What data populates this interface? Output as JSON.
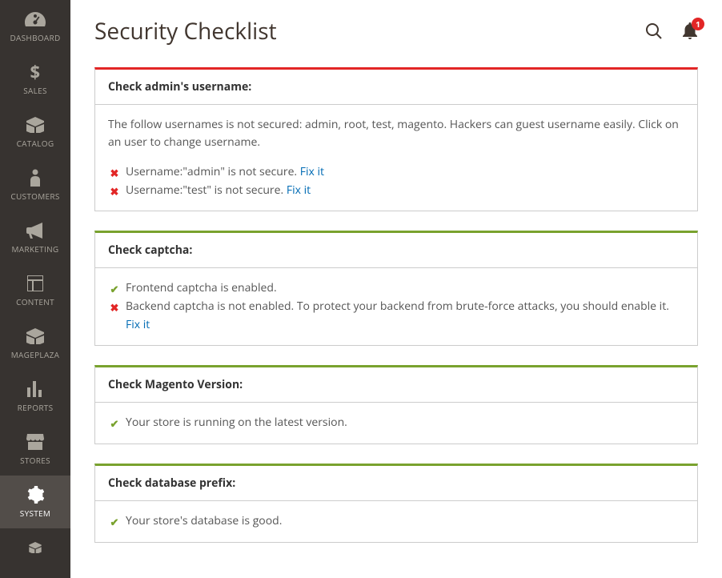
{
  "sidebar": {
    "items": [
      {
        "label": "DASHBOARD",
        "icon": "gauge"
      },
      {
        "label": "SALES",
        "icon": "dollar"
      },
      {
        "label": "CATALOG",
        "icon": "box"
      },
      {
        "label": "CUSTOMERS",
        "icon": "person"
      },
      {
        "label": "MARKETING",
        "icon": "megaphone"
      },
      {
        "label": "CONTENT",
        "icon": "layout"
      },
      {
        "label": "MAGEPLAZA",
        "icon": "box2"
      },
      {
        "label": "REPORTS",
        "icon": "bars"
      },
      {
        "label": "STORES",
        "icon": "store"
      },
      {
        "label": "SYSTEM",
        "icon": "gear",
        "active": true
      },
      {
        "label": "",
        "icon": "box3"
      }
    ]
  },
  "header": {
    "title": "Security Checklist",
    "badge": "1"
  },
  "cards": [
    {
      "status": "red",
      "title": "Check admin's username:",
      "desc": "The follow usernames is not secured: admin, root, test, magento. Hackers can guest username easily. Click on an user to change username.",
      "lines": [
        {
          "ok": false,
          "text": "Username:\"admin\" is not secure.",
          "fix": "Fix it"
        },
        {
          "ok": false,
          "text": "Username:\"test\" is not secure.",
          "fix": "Fix it"
        }
      ]
    },
    {
      "status": "green",
      "title": "Check captcha:",
      "desc": "",
      "lines": [
        {
          "ok": true,
          "text": "Frontend captcha is enabled."
        },
        {
          "ok": false,
          "text": "Backend captcha is not enabled. To protect your backend from brute-force attacks, you should enable it.",
          "fix": "Fix it"
        }
      ]
    },
    {
      "status": "green",
      "title": "Check Magento Version:",
      "desc": "",
      "lines": [
        {
          "ok": true,
          "text": "Your store is running on the latest version."
        }
      ]
    },
    {
      "status": "green",
      "title": "Check database prefix:",
      "desc": "",
      "lines": [
        {
          "ok": true,
          "text": "Your store's database is good."
        }
      ]
    }
  ]
}
